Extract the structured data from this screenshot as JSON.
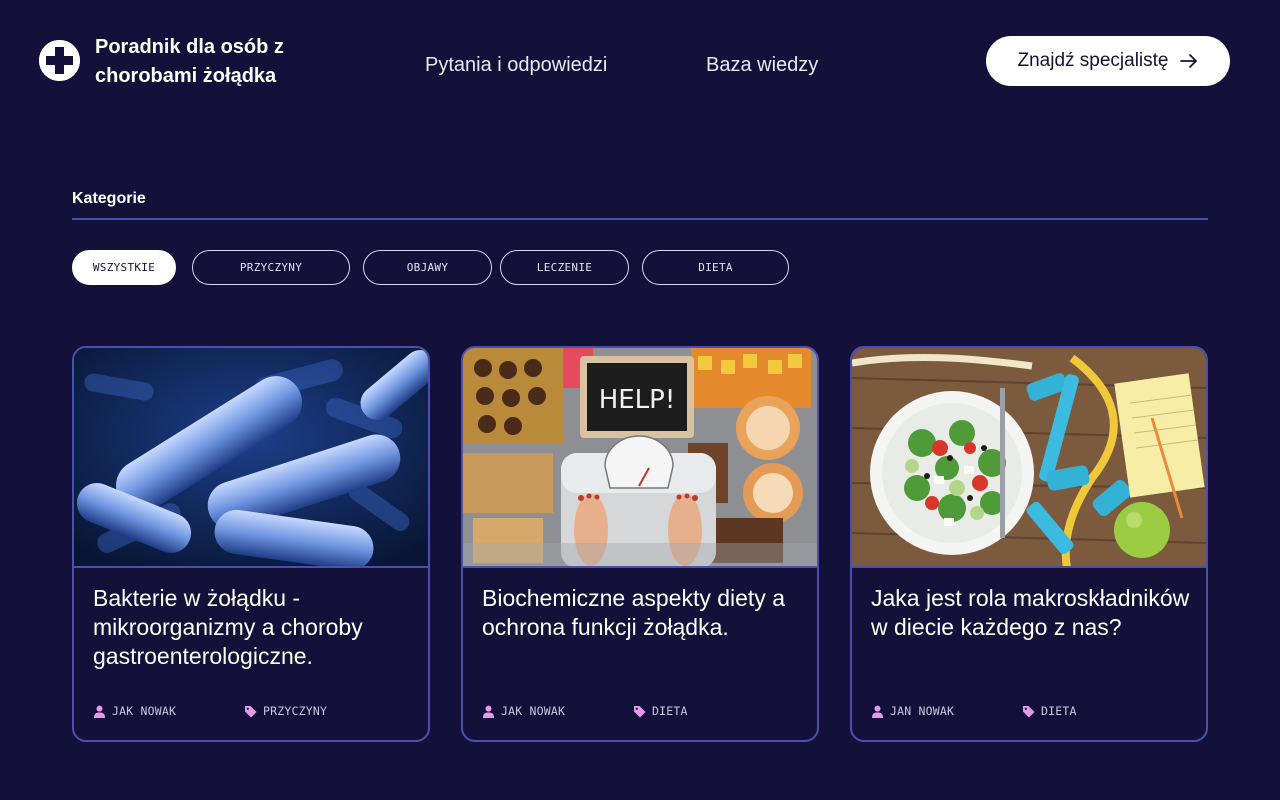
{
  "header": {
    "brand": "Poradnik dla osób z chorobami żołądka",
    "nav": [
      "Pytania i odpowiedzi",
      "Baza wiedzy"
    ],
    "cta_label": "Znajdź specjalistę"
  },
  "categories": {
    "title": "Kategorie",
    "chips": [
      "WSZYSTKIE",
      "PRZYCZYNY",
      "OBJAWY",
      "LECZENIE",
      "DIETA"
    ],
    "active": "WSZYSTKIE"
  },
  "articles": [
    {
      "title": "Bakterie w żołądku - mikroorganizmy a choroby gastroenterologiczne.",
      "author": "JAK NOWAK",
      "category": "PRZYCZYNY",
      "image": "bacteria-illustration"
    },
    {
      "title": "Biochemiczne aspekty diety a ochrona funkcji żołądka.",
      "author": "JAK NOWAK",
      "category": "DIETA",
      "image": "sweets-scale-help-sign"
    },
    {
      "title": "Jaka jest rola makroskładników w diecie każdego z nas?",
      "author": "JAN NOWAK",
      "category": "DIETA",
      "image": "salad-dumbbells-tape"
    }
  ],
  "icons": {
    "logo": "medical-cross-icon",
    "cta": "arrow-right-icon",
    "author": "user-icon",
    "category": "tag-icon"
  },
  "colors": {
    "background": "#13113a",
    "accent_border": "#4b4fb0",
    "meta_icon": "#e49ae8"
  }
}
